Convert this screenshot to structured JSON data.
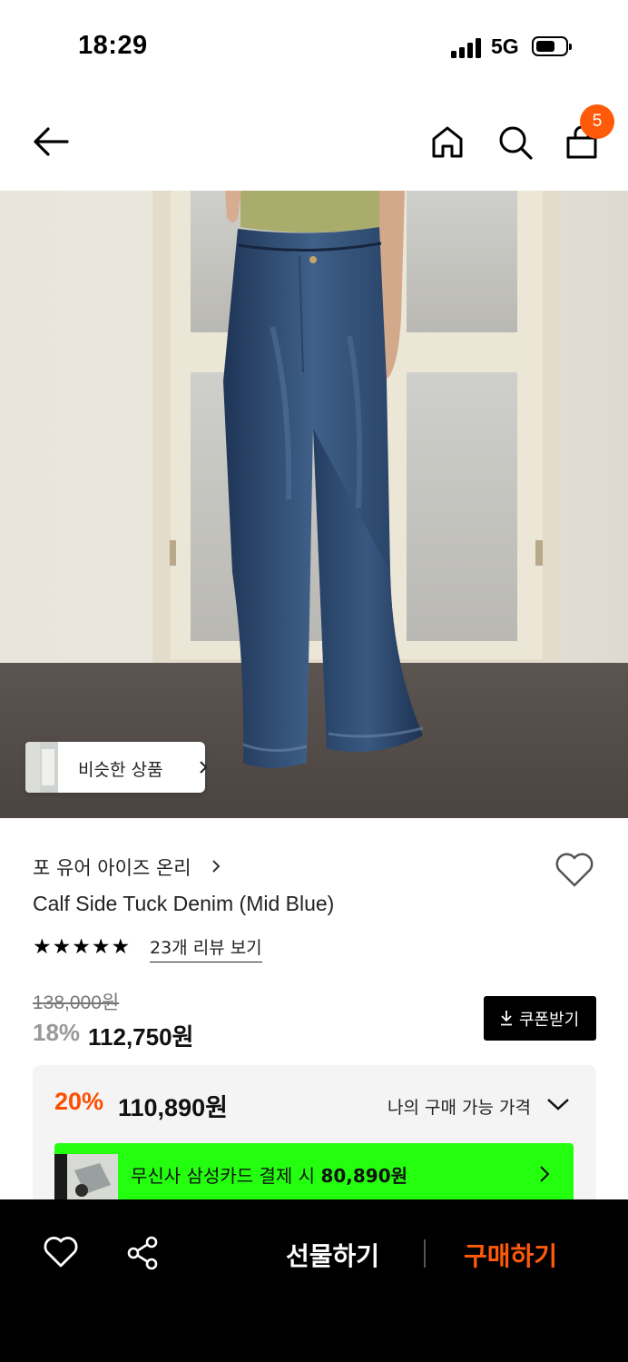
{
  "status_bar": {
    "time": "18:29",
    "network": "5G"
  },
  "header": {
    "cart_count": "5"
  },
  "hero": {
    "similar_label": "비슷한 상품"
  },
  "product": {
    "brand": "포 유어 아이즈 온리",
    "name": "Calf Side Tuck Denim (Mid Blue)",
    "rating_stars": 5,
    "review_link": "23개 리뷰 보기",
    "original_price": "138,000원",
    "discount_rate": "18%",
    "sale_price": "112,750원",
    "coupon_button": "쿠폰받기"
  },
  "member_price": {
    "discount_rate": "20%",
    "price": "110,890원",
    "toggle_label": "나의 구매 가능 가격",
    "card_offer": {
      "prefix": "무신사 삼성카드 결제 시 ",
      "amount": "80,890원"
    }
  },
  "bottom_bar": {
    "gift_label": "선물하기",
    "buy_label": "구매하기"
  },
  "colors": {
    "accent": "#ff5a0a",
    "discount": "#ff4d00",
    "card_banner": "#23ff0f",
    "bottom_bar": "#000000"
  }
}
